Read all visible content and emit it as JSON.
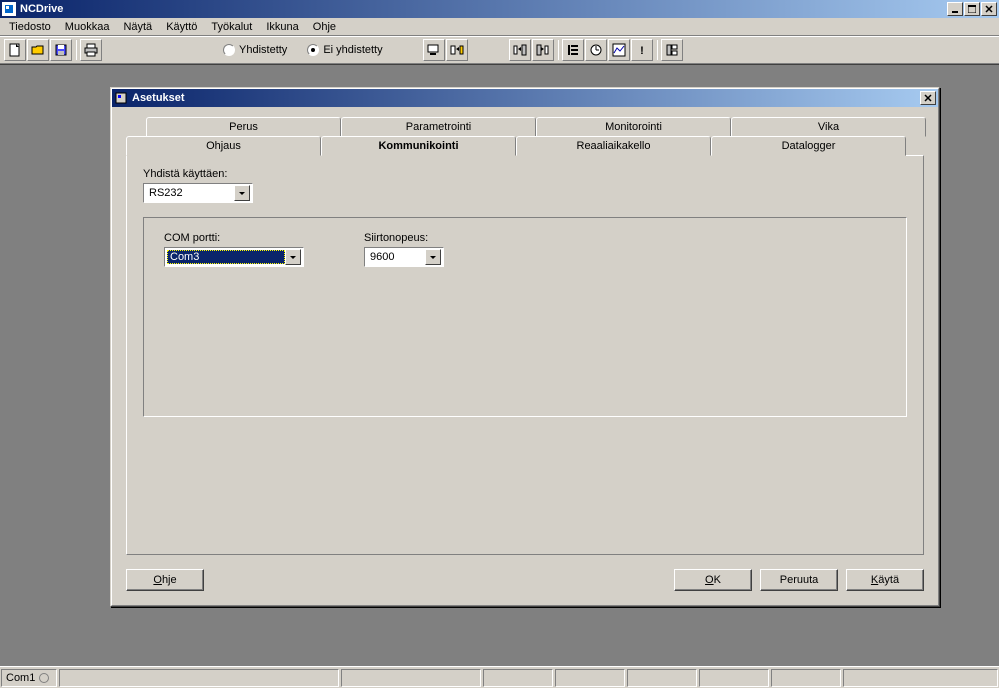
{
  "app": {
    "title": "NCDrive"
  },
  "menu": {
    "items": [
      "Tiedosto",
      "Muokkaa",
      "Näytä",
      "Käyttö",
      "Työkalut",
      "Ikkuna",
      "Ohje"
    ]
  },
  "toolbar": {
    "radio1": "Yhdistetty",
    "radio2": "Ei yhdistetty"
  },
  "dialog": {
    "title": "Asetukset",
    "tabs_row1": [
      "Perus",
      "Parametrointi",
      "Monitorointi",
      "Vika"
    ],
    "tabs_row2": [
      "Ohjaus",
      "Kommunikointi",
      "Reaaliaikakello",
      "Datalogger"
    ],
    "connect_label": "Yhdistä käyttäen:",
    "connect_value": "RS232",
    "com_label": "COM portti:",
    "com_value": "Com3",
    "baud_label": "Siirtonopeus:",
    "baud_value": "9600",
    "help_btn": "Ohje",
    "ok_btn": "OK",
    "cancel_btn": "Peruuta",
    "apply_btn": "Käytä"
  },
  "status": {
    "com": "Com1"
  }
}
